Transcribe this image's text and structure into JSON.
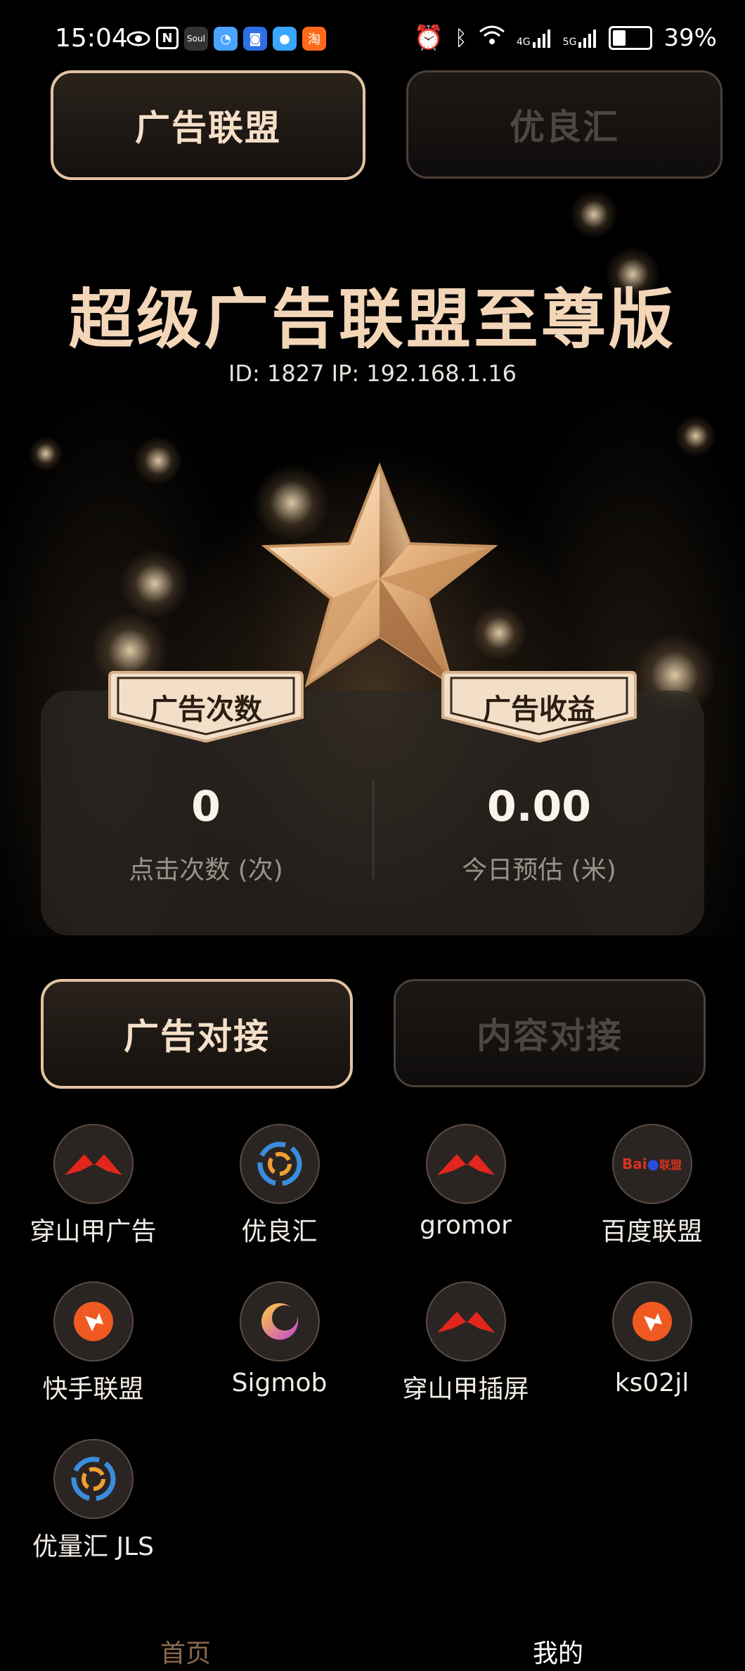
{
  "status_bar": {
    "time": "15:04",
    "notif_icons": [
      "eye-icon",
      "nfc-icon",
      "soul-app-icon",
      "chat-app-icon",
      "blue-app-icon",
      "qq-app-icon",
      "taobao-app-icon"
    ],
    "soul_label": "Soul",
    "taobao_label": "淘",
    "battery": "39%",
    "net_4g": "4G",
    "net_5g": "5G"
  },
  "top_tabs": [
    {
      "label": "广告联盟",
      "active": true
    },
    {
      "label": "优良汇",
      "active": false
    }
  ],
  "header": {
    "title": "超级广告联盟至尊版",
    "id_line": "ID: 1827  IP: 192.168.1.16"
  },
  "stats": {
    "left": {
      "badge": "广告次数",
      "value": "0",
      "label": "点击次数 (次)"
    },
    "right": {
      "badge": "广告收益",
      "value": "0.00",
      "label": "今日预估 (米)"
    }
  },
  "section_tabs": [
    {
      "label": "广告对接",
      "active": true
    },
    {
      "label": "内容对接",
      "active": false
    }
  ],
  "platforms": [
    {
      "label": "穿山甲广告",
      "icon": "pangle-icon"
    },
    {
      "label": "优良汇",
      "icon": "ylh-icon"
    },
    {
      "label": "gromor",
      "icon": "pangle-icon"
    },
    {
      "label": "百度联盟",
      "icon": "baidu-icon"
    },
    {
      "label": "快手联盟",
      "icon": "kuaishou-icon"
    },
    {
      "label": "Sigmob",
      "icon": "sigmob-icon"
    },
    {
      "label": "穿山甲插屏",
      "icon": "pangle-icon"
    },
    {
      "label": "ks02jl",
      "icon": "kuaishou-icon"
    },
    {
      "label": "优量汇 JLS",
      "icon": "ylh-icon"
    }
  ],
  "baidu_logo": {
    "text1": "Bai",
    "text2": "联盟"
  },
  "bottom_nav": [
    {
      "label": "首页",
      "active": true
    },
    {
      "label": "我的",
      "active": false
    }
  ],
  "colors": {
    "gold": "#e3c3a2",
    "title": "#f3d6b8",
    "nav_active": "#8a6a4d"
  }
}
